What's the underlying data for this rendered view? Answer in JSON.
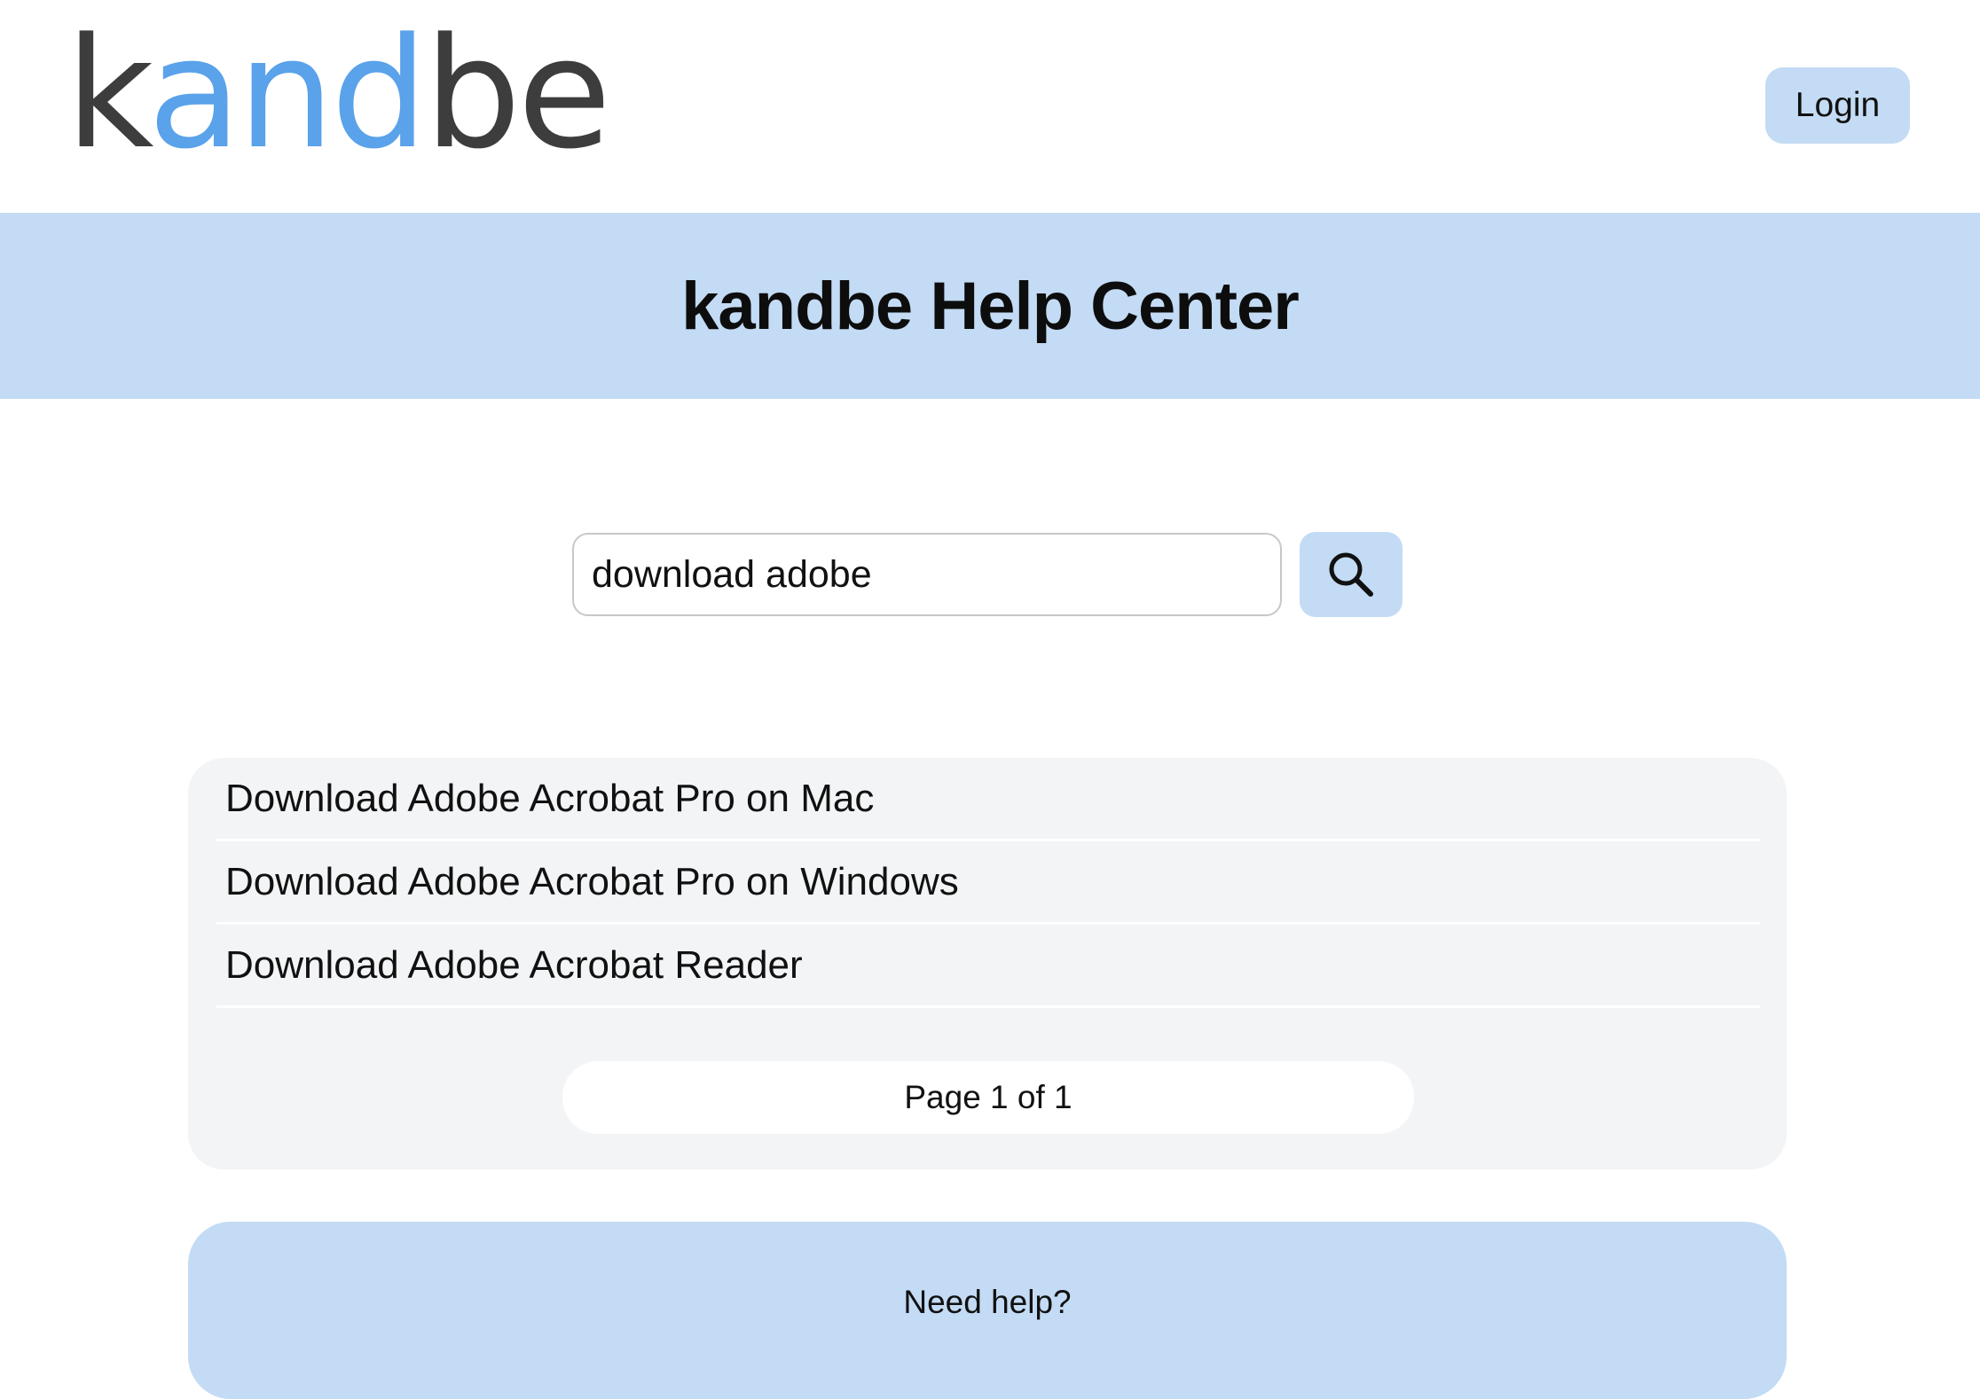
{
  "header": {
    "logo": {
      "part1": "k",
      "part2": "and",
      "part3": "be"
    },
    "login_label": "Login"
  },
  "hero": {
    "title": "kandbe Help Center"
  },
  "search": {
    "value": "download adobe",
    "button_icon": "search-icon"
  },
  "results": {
    "items": [
      {
        "title": "Download Adobe Acrobat Pro on Mac"
      },
      {
        "title": "Download Adobe Acrobat Pro on Windows"
      },
      {
        "title": "Download Adobe Acrobat Reader"
      }
    ],
    "pagination": "Page 1 of 1"
  },
  "help": {
    "title": "Need help?"
  },
  "colors": {
    "accent_light": "#c3dbf4",
    "logo_blue": "#5aa2ea",
    "logo_dark": "#3d3d3d",
    "panel_gray": "#f3f4f6"
  }
}
